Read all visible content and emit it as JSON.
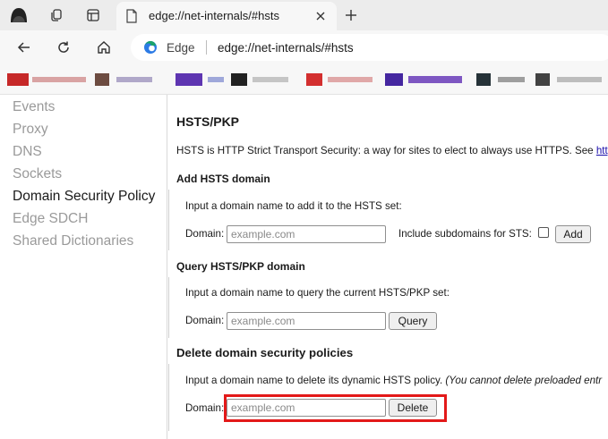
{
  "tab": {
    "title": "edge://net-internals/#hsts",
    "close_glyph": "✕"
  },
  "newtab_glyph": "+",
  "address_bar": {
    "site_label": "Edge",
    "url": "edge://net-internals/#hsts"
  },
  "colors": {
    "highlight": "#e31919",
    "link": "#1a0dab",
    "inactive_nav": "#9a9a9a"
  },
  "sidebar": {
    "items": [
      {
        "label": "Events"
      },
      {
        "label": "Proxy"
      },
      {
        "label": "DNS"
      },
      {
        "label": "Sockets"
      },
      {
        "label": "Domain Security Policy",
        "active": true
      },
      {
        "label": "Edge SDCH"
      },
      {
        "label": "Shared Dictionaries"
      }
    ]
  },
  "main": {
    "title": "HSTS/PKP",
    "description": "HSTS is HTTP Strict Transport Security: a way for sites to elect to always use HTTPS. See ",
    "description_link": "http",
    "add": {
      "heading": "Add HSTS domain",
      "hint": "Input a domain name to add it to the HSTS set:",
      "domain_label": "Domain:",
      "placeholder": "example.com",
      "subdomains_label": "Include subdomains for STS:",
      "button": "Add"
    },
    "query": {
      "heading": "Query HSTS/PKP domain",
      "hint": "Input a domain name to query the current HSTS/PKP set:",
      "domain_label": "Domain:",
      "placeholder": "example.com",
      "button": "Query"
    },
    "delete": {
      "heading": "Delete domain security policies",
      "hint": "Input a domain name to delete its dynamic HSTS policy. ",
      "hint_italic": "(You cannot delete preloaded entr",
      "domain_label": "Domain:",
      "placeholder": "example.com",
      "button": "Delete"
    }
  }
}
